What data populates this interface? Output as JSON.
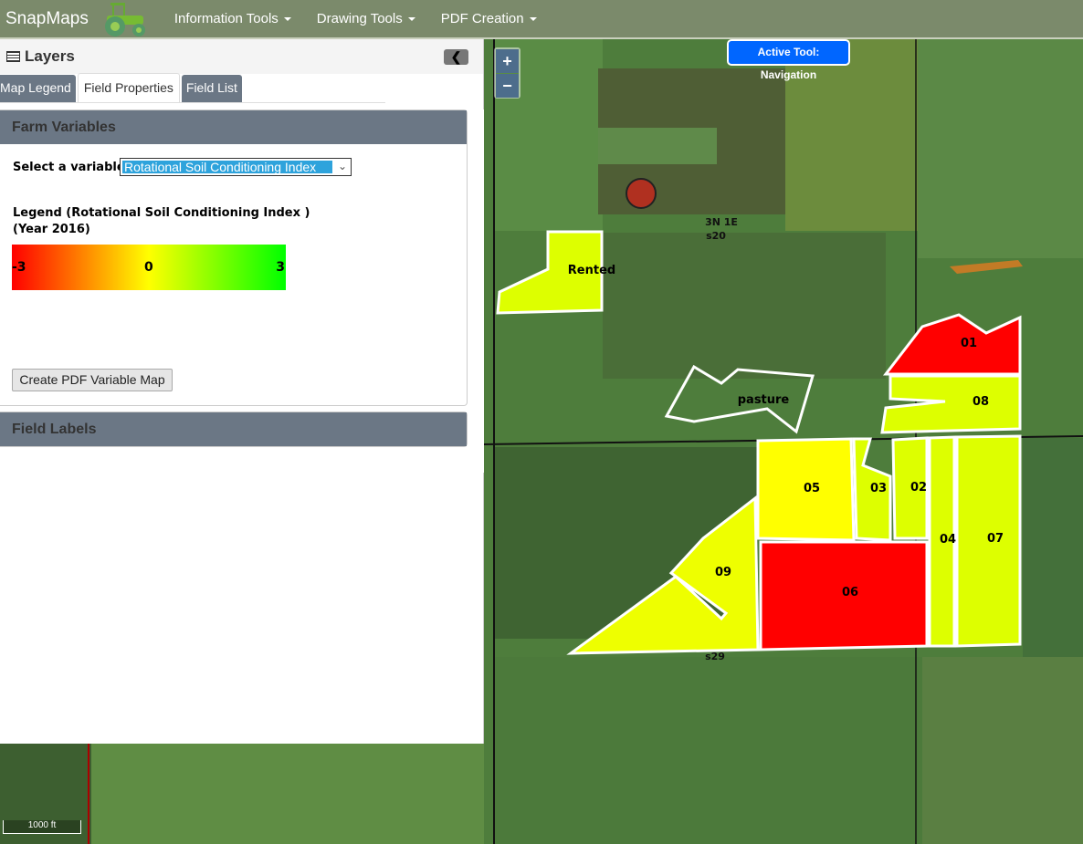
{
  "app": {
    "title": "SnapMaps"
  },
  "nav": {
    "menus": [
      "Information Tools",
      "Drawing Tools",
      "PDF Creation"
    ]
  },
  "panel": {
    "title": "Layers",
    "tabs": [
      "Map Legend",
      "Field Properties",
      "Field List"
    ],
    "active_tab": "Field Properties",
    "farm_variables": {
      "title": "Farm Variables",
      "select_label": "Select a variable:",
      "selected": "Rotational Soil Conditioning Index",
      "legend_title": "Legend (Rotational Soil Conditioning Index )",
      "legend_year": "(Year 2016)",
      "legend_min": "-3",
      "legend_mid": "0",
      "legend_max": "3",
      "colors": {
        "min": "#ff0000",
        "mid": "#ffff00",
        "max": "#00ff00"
      },
      "pdf_button": "Create PDF Variable Map"
    },
    "field_labels": {
      "title": "Field Labels"
    }
  },
  "map": {
    "active_tool": "Active Tool: Navigation",
    "zoom_in": "+",
    "zoom_out": "−",
    "scale": "1000 ft",
    "section_labels": {
      "north_line1": "3N 1E",
      "north_line2": "s20",
      "south": "s29"
    },
    "fields": [
      {
        "label": "Rented",
        "color": "#ddff00"
      },
      {
        "label": "pasture",
        "color": "none"
      },
      {
        "label": "01",
        "color": "#ff0000"
      },
      {
        "label": "08",
        "color": "#ddff00"
      },
      {
        "label": "05",
        "color": "#ffff00"
      },
      {
        "label": "03",
        "color": "#ddff00"
      },
      {
        "label": "02",
        "color": "#ddff00"
      },
      {
        "label": "04",
        "color": "#ddff00"
      },
      {
        "label": "07",
        "color": "#ddff00"
      },
      {
        "label": "09",
        "color": "#eeff00"
      },
      {
        "label": "06",
        "color": "#ff0000"
      }
    ]
  }
}
